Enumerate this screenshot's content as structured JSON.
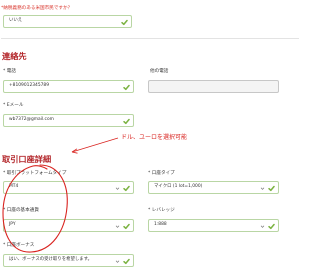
{
  "q_us": {
    "label": "*納税義務のある米国市民ですか？",
    "value": "いいえ"
  },
  "contact": {
    "title": "連絡先",
    "phone_label": "電話",
    "phone_value": "+8109012345789",
    "other_phone_label": "他の電話",
    "other_phone_value": "",
    "email_label": "Eメール",
    "email_value": "wb7372@gmail.com"
  },
  "annotation": "ドル、ユーロを選択可能",
  "account": {
    "title": "取引口座詳細",
    "platform_label": "取引プラットフォームタイプ",
    "platform_value": "MT4",
    "type_label": "口座タイプ",
    "type_value": "マイクロ (1 lot=1,000)",
    "currency_label": "口座の基本通貨",
    "currency_value": "JPY",
    "leverage_label": "レバレッジ",
    "leverage_value": "1:888",
    "bonus_label": "口座ボーナス",
    "bonus_value": "はい、ボーナスの受け取りを希望します。"
  },
  "colors": {
    "accent": "#b3262a",
    "valid": "#7cb342",
    "annotation": "#d9231f"
  }
}
